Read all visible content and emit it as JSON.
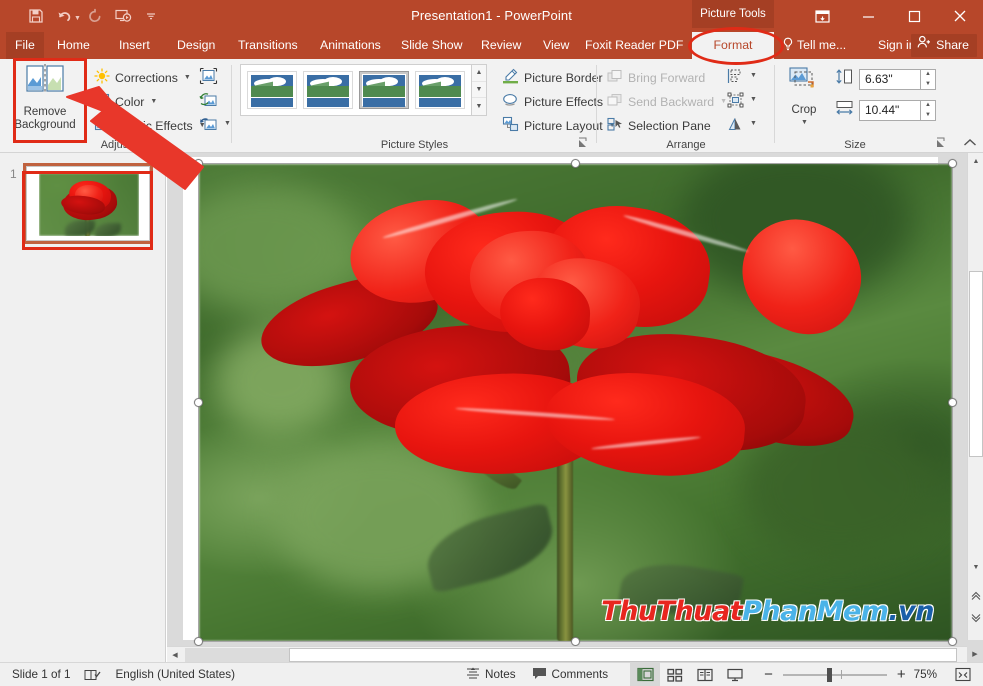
{
  "window": {
    "title": "Presentation1 - PowerPoint",
    "contextual_tab_group": "Picture Tools",
    "quick_access": [
      {
        "name": "save-icon",
        "label": "Save"
      },
      {
        "name": "undo-icon",
        "label": "Undo"
      },
      {
        "name": "redo-icon",
        "label": "Redo"
      },
      {
        "name": "start-slideshow-icon",
        "label": "Start From Beginning"
      },
      {
        "name": "customize-qat-icon",
        "label": "Customize Quick Access Toolbar"
      }
    ],
    "controls": [
      {
        "name": "ribbon-display-options-icon",
        "label": "Ribbon Display Options"
      },
      {
        "name": "minimize-icon",
        "label": "Minimize"
      },
      {
        "name": "maximize-icon",
        "label": "Restore Down"
      },
      {
        "name": "close-icon",
        "label": "Close"
      }
    ]
  },
  "tabs": [
    {
      "label": "File",
      "active": false
    },
    {
      "label": "Home",
      "active": false
    },
    {
      "label": "Insert",
      "active": false
    },
    {
      "label": "Design",
      "active": false
    },
    {
      "label": "Transitions",
      "active": false
    },
    {
      "label": "Animations",
      "active": false
    },
    {
      "label": "Slide Show",
      "active": false
    },
    {
      "label": "Review",
      "active": false
    },
    {
      "label": "View",
      "active": false
    },
    {
      "label": "Foxit Reader PDF",
      "active": false
    },
    {
      "label": "Format",
      "active": true
    }
  ],
  "tell_me": "Tell me...",
  "sign_in": "Sign in",
  "share": "Share",
  "ribbon": {
    "groups": [
      {
        "name": "adjust",
        "label": "Adjust"
      },
      {
        "name": "picture-styles",
        "label": "Picture Styles"
      },
      {
        "name": "arrange",
        "label": "Arrange"
      },
      {
        "name": "size",
        "label": "Size"
      }
    ],
    "adjust": {
      "remove_background": "Remove\nBackground",
      "remove_background_line1": "Remove",
      "remove_background_line2": "Background",
      "corrections": "Corrections",
      "color": "Color",
      "artistic_effects": "Artistic Effects",
      "compress_pictures_icon": "compress-pictures-icon",
      "change_picture_icon": "change-picture-icon",
      "reset_picture_icon": "reset-picture-icon"
    },
    "picture_styles": {
      "styles_count": 4,
      "selected_index": 2,
      "picture_border": "Picture Border",
      "picture_effects": "Picture Effects",
      "picture_layout": "Picture Layout"
    },
    "arrange": {
      "bring_forward": "Bring Forward",
      "send_backward": "Send Backward",
      "selection_pane": "Selection Pane",
      "align_icon": "align-objects-icon",
      "group_icon": "group-objects-icon",
      "rotate_icon": "rotate-objects-icon"
    },
    "size": {
      "crop": "Crop",
      "height_value": "6.63\"",
      "width_value": "10.44\"",
      "height_icon": "shape-height-icon",
      "width_icon": "shape-width-icon"
    },
    "collapse": "collapse-ribbon-icon"
  },
  "slides": {
    "thumbnails": [
      {
        "number": "1",
        "selected": true
      }
    ]
  },
  "slide_image": {
    "watermark_part1": "ThuThuat",
    "watermark_part2": "PhanMem",
    "watermark_part3": ".vn",
    "description": "red rose photograph on blurred green background"
  },
  "status_bar": {
    "slide_count": "Slide 1 of 1",
    "language": "English (United States)",
    "notes": "Notes",
    "comments": "Comments",
    "zoom_level": "75%",
    "views": [
      {
        "name": "normal-view-button",
        "active": true
      },
      {
        "name": "slide-sorter-view-button",
        "active": false
      },
      {
        "name": "reading-view-button",
        "active": false
      },
      {
        "name": "slide-show-button",
        "active": false
      }
    ],
    "zoom_out": "−",
    "zoom_in": "+",
    "fit_slide_icon": "fit-slide-to-window-icon",
    "accessibility_icon": "accessibility-checker-icon"
  },
  "annotations": [
    {
      "name": "remove-background-highlight",
      "type": "rectangle"
    },
    {
      "name": "format-tab-highlight",
      "type": "ellipse"
    },
    {
      "name": "thumbnail-highlight",
      "type": "rectangle"
    },
    {
      "name": "pointer-arrow",
      "type": "arrow"
    }
  ],
  "colors": {
    "accent": "#b7472a",
    "annotation": "#e02b17",
    "ribbon_bg": "#f2f2f2",
    "workspace_bg": "#dadada"
  }
}
